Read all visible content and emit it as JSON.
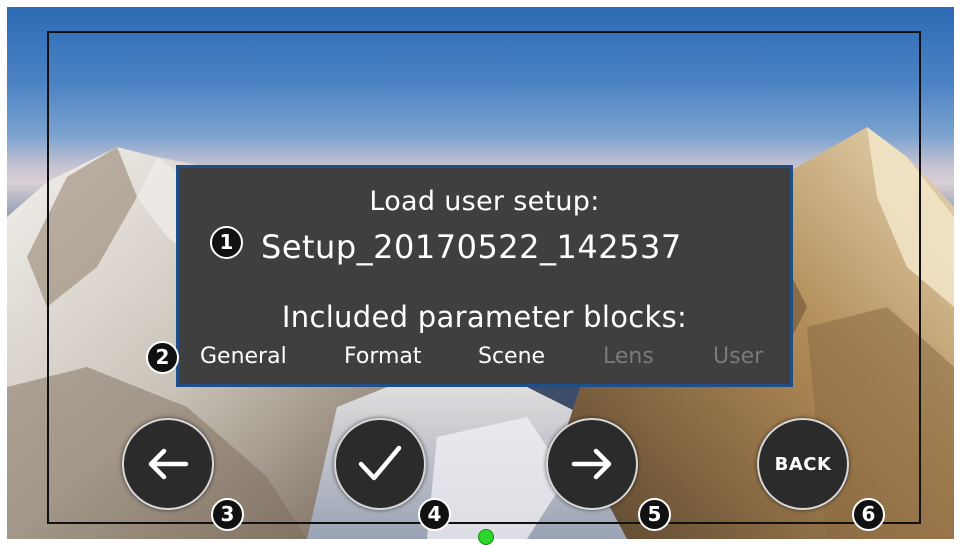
{
  "dialog": {
    "title": "Load user setup:",
    "setup_name": "Setup_20170522_142537",
    "params_title": "Included parameter blocks:",
    "blocks": [
      {
        "label": "General",
        "enabled": true
      },
      {
        "label": "Format",
        "enabled": true
      },
      {
        "label": "Scene",
        "enabled": true
      },
      {
        "label": "Lens",
        "enabled": false
      },
      {
        "label": "User",
        "enabled": false
      }
    ]
  },
  "callouts": [
    "1",
    "2",
    "3",
    "4",
    "5",
    "6"
  ],
  "buttons": {
    "prev_icon": "arrow-left-icon",
    "confirm_icon": "checkmark-icon",
    "next_icon": "arrow-right-icon",
    "back_label": "BACK"
  },
  "colors": {
    "dialog_bg": "#3f3f3f",
    "dialog_border": "#1f4f86",
    "disabled_text": "#7a7a7a",
    "indicator": "#2bd62b"
  },
  "background": "snowy-mountain-photo"
}
